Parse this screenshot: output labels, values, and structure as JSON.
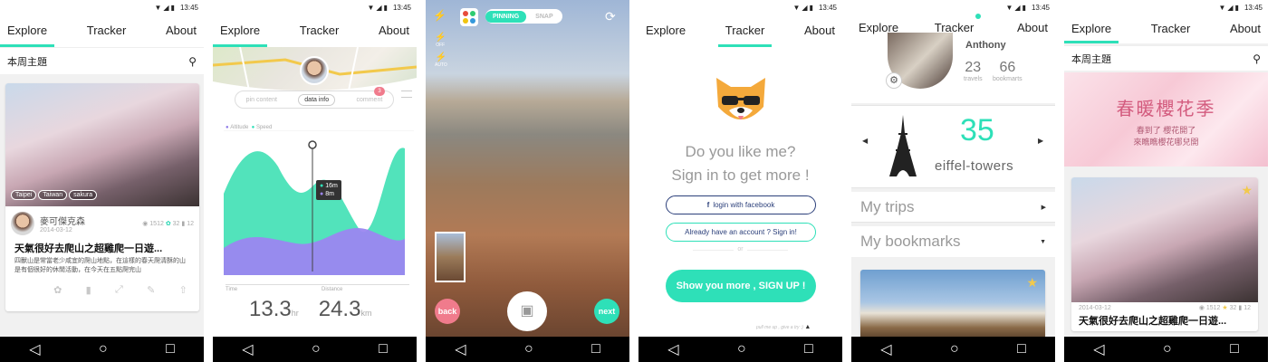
{
  "statusbar": {
    "time": "13:45",
    "icons": "▼◢▮"
  },
  "nav": {
    "explore": "Explore",
    "tracker": "Tracker",
    "about": "About"
  },
  "s1": {
    "section_title": "本周主題",
    "tags": [
      "Taipei",
      "Taiwan",
      "sakura"
    ],
    "author": "麥可傑克森",
    "date": "2014-03-12",
    "views": "1512",
    "likes": "32",
    "comments": "12",
    "post_title": "天氣很好去爬山之超雞爬一日遊...",
    "excerpt": "四獸山是常當老少咸宜的爬山地點，在這樣的春天爬清酥的山是有個很好的休閒活動，在今天在五點爬完山"
  },
  "s2": {
    "tabs": [
      "pin content",
      "data info",
      "comment"
    ],
    "comment_badge": "3",
    "legend": [
      "Altitude",
      "Speed"
    ],
    "tooltip": [
      "16m",
      "8m"
    ],
    "time_label": "Time",
    "distance_label": "Distance",
    "time_value": "13.3",
    "time_unit": "hr",
    "distance_value": "24.3",
    "distance_unit": "km"
  },
  "s3": {
    "mode_pinning": "PINNING",
    "mode_snap": "SNAP",
    "side_labels": [
      "OFF",
      "AUTO"
    ],
    "back": "back",
    "next": "next"
  },
  "s4": {
    "line1": "Do you like me?",
    "line2": "Sign in to get more !",
    "facebook": "login with facebook",
    "signin": "Already have an account ? Sign in!",
    "or": "or",
    "signup": "Show you more , SIGN UP !",
    "footer": "pull me up , give a try :)"
  },
  "s5": {
    "name": "Anthony",
    "travels_count": "23",
    "travels_label": "travels",
    "bookmarks_count": "66",
    "bookmarks_label": "bookmarts",
    "landmark_count": "35",
    "landmark_label": "eiffel-towers",
    "my_trips": "My trips",
    "my_bookmarks": "My bookmarks"
  },
  "s6": {
    "section_title": "本周主題",
    "banner_title": "春暖櫻花季",
    "banner_line1": "春到了 櫻花開了",
    "banner_line2": "來瞧瞧櫻花哪兒開",
    "date": "2014-03-12",
    "views": "1512",
    "likes": "32",
    "comments": "12",
    "post_title": "天氣很好去爬山之超雞爬一日遊..."
  },
  "colors": {
    "accent": "#2ee0b8",
    "navy": "#2b3f7a",
    "purple": "#8f7be8",
    "red": "#f07b8c"
  },
  "sysnav": {
    "back": "◁",
    "home": "○",
    "recent": "□"
  }
}
